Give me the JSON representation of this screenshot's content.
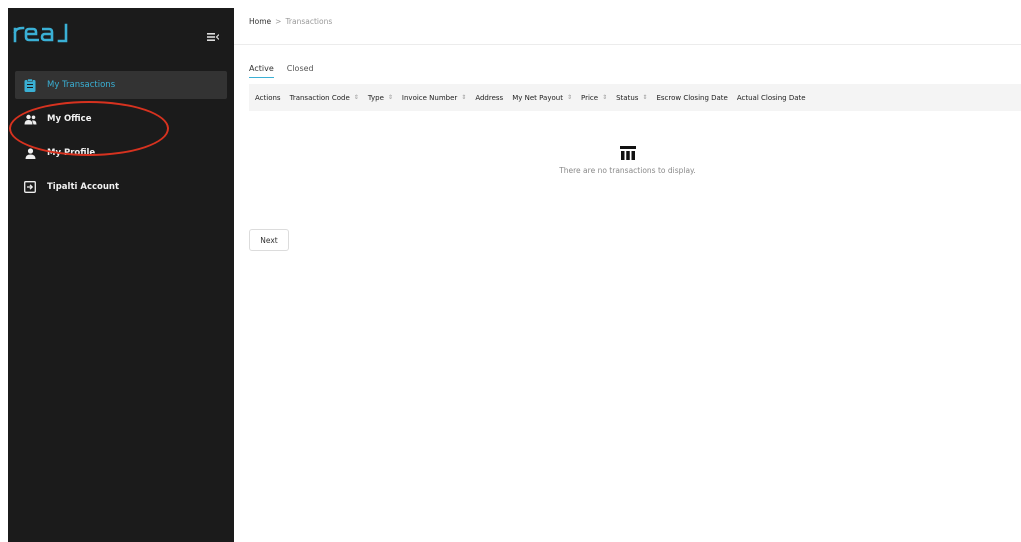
{
  "brand": {
    "logo_text": "real",
    "accent_color": "#3ab0d5"
  },
  "sidebar": {
    "collapse_icon": "collapse-menu-icon",
    "items": [
      {
        "label": "My Transactions",
        "icon": "transactions-icon",
        "active": true
      },
      {
        "label": "My Office",
        "icon": "office-people-icon",
        "active": false
      },
      {
        "label": "My Profile",
        "icon": "profile-icon",
        "active": false
      },
      {
        "label": "Tipalti Account",
        "icon": "account-login-icon",
        "active": false
      }
    ]
  },
  "annotation": {
    "color": "#d7321f",
    "target": "My Office"
  },
  "breadcrumb": {
    "home": "Home",
    "separator": ">",
    "current": "Transactions"
  },
  "tabs": [
    {
      "label": "Active",
      "active": true
    },
    {
      "label": "Closed",
      "active": false
    }
  ],
  "table": {
    "columns": [
      {
        "label": "Actions",
        "sortable": false
      },
      {
        "label": "Transaction Code",
        "sortable": true
      },
      {
        "label": "Type",
        "sortable": true
      },
      {
        "label": "Invoice Number",
        "sortable": true
      },
      {
        "label": "Address",
        "sortable": false
      },
      {
        "label": "My Net Payout",
        "sortable": true
      },
      {
        "label": "Price",
        "sortable": true
      },
      {
        "label": "Status",
        "sortable": true
      },
      {
        "label": "Escrow Closing Date",
        "sortable": false
      },
      {
        "label": "Actual Closing Date",
        "sortable": false
      }
    ],
    "sort_glyph": "⇕",
    "empty_icon": "table-columns-icon",
    "empty_message": "There are no transactions to display."
  },
  "pagination": {
    "next_label": "Next"
  }
}
